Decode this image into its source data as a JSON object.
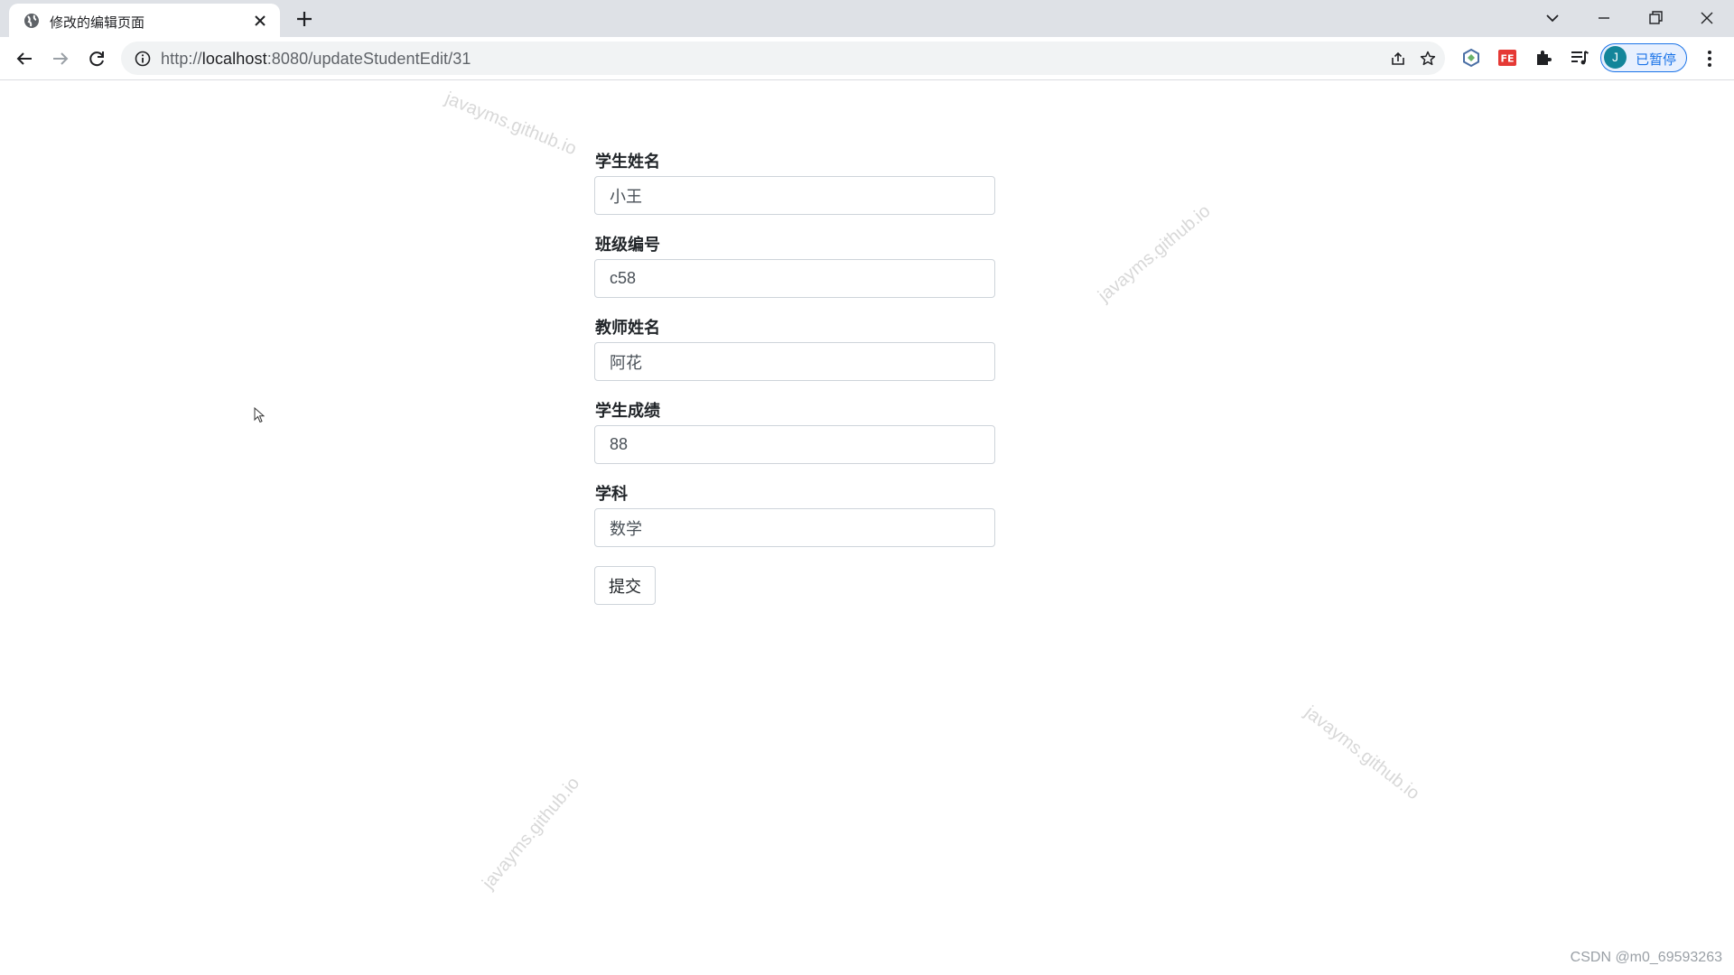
{
  "browser": {
    "tab": {
      "title": "修改的编辑页面"
    },
    "url": {
      "scheme": "http://",
      "host": "localhost",
      "rest": ":8080/updateStudentEdit/31"
    },
    "profile": {
      "initial": "J",
      "label": "已暂停"
    }
  },
  "form": {
    "fields": [
      {
        "label": "学生姓名",
        "value": "小王"
      },
      {
        "label": "班级编号",
        "value": "c58"
      },
      {
        "label": "教师姓名",
        "value": "阿花"
      },
      {
        "label": "学生成绩",
        "value": "88"
      },
      {
        "label": "学科",
        "value": "数学"
      }
    ],
    "submit_label": "提交"
  },
  "watermark": {
    "text": "javayms.github.io"
  },
  "footer": {
    "credit": "CSDN @m0_69593263"
  },
  "colors": {
    "accent": "#1a73e8",
    "avatar": "#13859a",
    "tabstrip": "#dee1e6"
  }
}
